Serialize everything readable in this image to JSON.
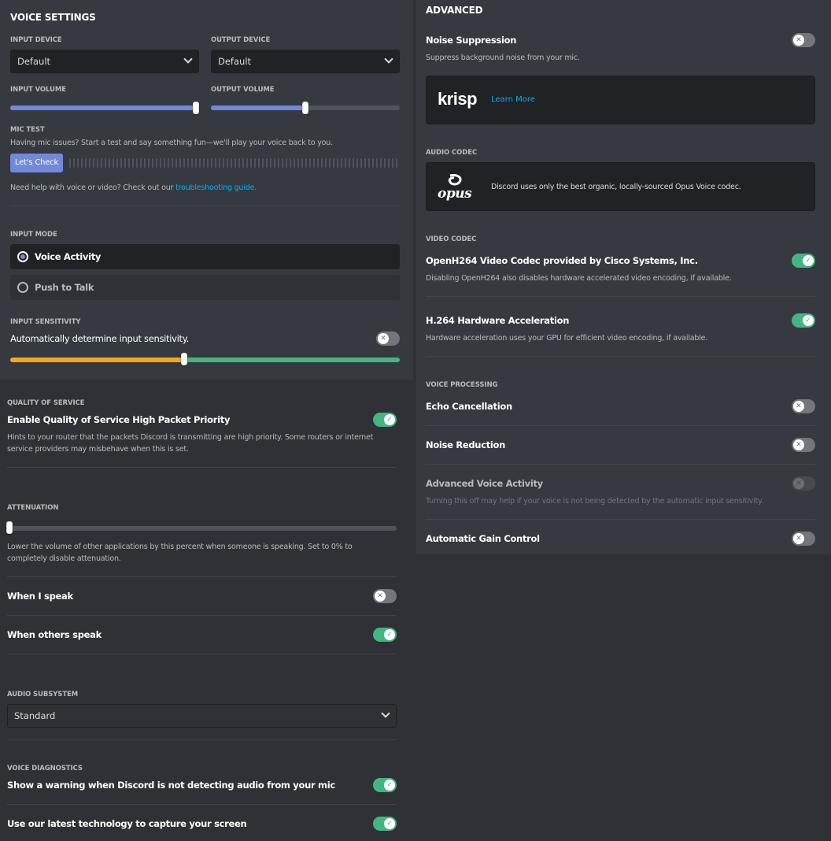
{
  "voice_settings": {
    "title": "VOICE SETTINGS",
    "input_device_label": "INPUT DEVICE",
    "input_device_value": "Default",
    "output_device_label": "OUTPUT DEVICE",
    "output_device_value": "Default",
    "input_volume_label": "INPUT VOLUME",
    "input_volume_fraction": 1.0,
    "output_volume_label": "OUTPUT VOLUME",
    "output_volume_fraction": 0.5,
    "mic_test_label": "MIC TEST",
    "mic_test_desc": "Having mic issues? Start a test and say something fun—we'll play your voice back to you.",
    "mic_test_button": "Let's Check",
    "help_text": "Need help with voice or video? Check out our",
    "help_link": "troubleshooting guide.",
    "input_mode_label": "INPUT MODE",
    "input_mode_options": [
      "Voice Activity",
      "Push to Talk"
    ],
    "input_mode_selected": "Voice Activity",
    "input_sensitivity_label": "INPUT SENSITIVITY",
    "auto_sensitivity_label": "Automatically determine input sensitivity.",
    "auto_sensitivity_on": false,
    "sensitivity_threshold_fraction": 0.45
  },
  "qos": {
    "label": "QUALITY OF SERVICE",
    "title": "Enable Quality of Service High Packet Priority",
    "on": true,
    "desc": "Hints to your router that the packets Discord is transmitting are high priority. Some routers or internet service providers may misbehave when this is set."
  },
  "attenuation": {
    "label": "ATTENUATION",
    "value_fraction": 0,
    "desc": "Lower the volume of other applications by this percent when someone is speaking. Set to 0% to completely disable attenuation.",
    "when_i_speak": "When I speak",
    "when_i_speak_on": false,
    "when_others_speak": "When others speak",
    "when_others_speak_on": true
  },
  "audio_subsystem": {
    "label": "AUDIO SUBSYSTEM",
    "value": "Standard"
  },
  "voice_diagnostics": {
    "label": "VOICE DIAGNOSTICS",
    "warning_title": "Show a warning when Discord is not detecting audio from your mic",
    "warning_on": true,
    "capture_title": "Use our latest technology to capture your screen",
    "capture_on": true
  },
  "advanced": {
    "title": "ADVANCED",
    "noise_suppression_title": "Noise Suppression",
    "noise_suppression_desc": "Suppress background noise from your mic.",
    "noise_suppression_on": false,
    "krisp_logo": "krisp",
    "krisp_link": "Learn More",
    "audio_codec_label": "AUDIO CODEC",
    "opus_logo": "opus",
    "opus_desc": "Discord uses only the best organic, locally-sourced Opus Voice codec.",
    "video_codec_label": "VIDEO CODEC",
    "openh264_title": "OpenH264 Video Codec provided by Cisco Systems, Inc.",
    "openh264_desc": "Disabling OpenH264 also disables hardware accelerated video encoding, if available.",
    "openh264_on": true,
    "h264_title": "H.264 Hardware Acceleration",
    "h264_desc": "Hardware acceleration uses your GPU for efficient video encoding, if available.",
    "h264_on": true,
    "voice_processing_label": "VOICE PROCESSING",
    "echo_title": "Echo Cancellation",
    "echo_on": false,
    "noise_reduction_title": "Noise Reduction",
    "noise_reduction_on": false,
    "ava_title": "Advanced Voice Activity",
    "ava_desc": "Turning this off may help if your voice is not being detected by the automatic input sensitivity.",
    "ava_on": false,
    "agc_title": "Automatic Gain Control",
    "agc_on": false
  },
  "colors": {
    "blurple": "#7289da",
    "green": "#43b581",
    "yellow": "#faa61a",
    "link": "#00b0f4"
  }
}
